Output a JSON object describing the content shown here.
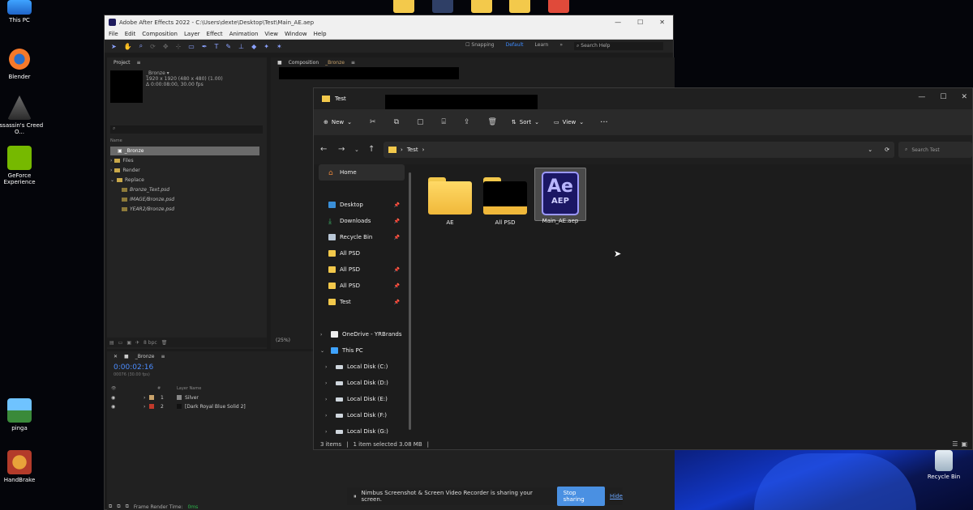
{
  "desktop": {
    "icons": [
      {
        "label": "This PC",
        "icon": "monitor-icon"
      },
      {
        "label": "Blender",
        "icon": "blender-icon"
      },
      {
        "label": "Assassin's Creed O...",
        "icon": "assassins-creed-icon"
      },
      {
        "label": "GeForce Experience",
        "icon": "geforce-icon"
      },
      {
        "label": "pinga",
        "icon": "image-icon"
      },
      {
        "label": "HandBrake",
        "icon": "handbrake-icon"
      },
      {
        "label": "Recycle Bin",
        "icon": "recycle-bin-icon"
      }
    ]
  },
  "ae": {
    "title": "Adobe After Effects 2022 - C:\\Users\\dexte\\Desktop\\Test\\Main_AE.aep",
    "menu": [
      "File",
      "Edit",
      "Composition",
      "Layer",
      "Effect",
      "Animation",
      "View",
      "Window",
      "Help"
    ],
    "snapping": "Snapping",
    "workspace_default": "Default",
    "workspace_learn": "Learn",
    "search_help": "Search Help",
    "project_tab": "Project",
    "comp_tab": "Composition",
    "comp_name": "_Bronze",
    "info_name": "_Bronze ▾",
    "info_line1": "1920 x 1920  (480 x 480) (1.00)",
    "info_line2": "Δ 0:00:08:00, 30.00 fps",
    "col_name": "Name",
    "project_items": [
      {
        "label": "_Bronze",
        "level": 0,
        "selected": true
      },
      {
        "label": "Files",
        "level": 0,
        "selected": false
      },
      {
        "label": "Render",
        "level": 0,
        "selected": false
      },
      {
        "label": "Replace",
        "level": 0,
        "selected": false
      },
      {
        "label": "Bronze_Text.psd",
        "level": 1,
        "selected": false
      },
      {
        "label": "IMAGE/Bronze.psd",
        "level": 1,
        "selected": false
      },
      {
        "label": "YEAR2/Bronze.psd",
        "level": 1,
        "selected": false
      }
    ],
    "bpc": "8 bpc",
    "zoom": "(25%)",
    "timecode": "0:00:02:16",
    "fps_small": "00076 (30.00 fps)",
    "layer_col": "Layer Name",
    "layers": [
      {
        "num": "1",
        "name": "Silver",
        "color": "#c9a36b"
      },
      {
        "num": "2",
        "name": "[Dark Royal Blue Solid 2]",
        "color": "#c0392b"
      }
    ],
    "frame_render_label": "Frame Render Time:",
    "frame_render_value": "0ms"
  },
  "explorer": {
    "tab_title": "Test",
    "cmd_new": "New",
    "cmd_sort": "Sort",
    "cmd_view": "View",
    "address_seg": "Test",
    "search_placeholder": "Search Test",
    "sidebar": [
      {
        "label": "Home",
        "icon": "home-icon",
        "pinned": false,
        "expand": ""
      },
      {
        "label": "Desktop",
        "icon": "desktop-icon",
        "pinned": true,
        "expand": ""
      },
      {
        "label": "Downloads",
        "icon": "download-icon",
        "pinned": true,
        "expand": ""
      },
      {
        "label": "Recycle Bin",
        "icon": "recycle-bin-icon",
        "pinned": true,
        "expand": ""
      },
      {
        "label": "All PSD",
        "icon": "folder-icon",
        "pinned": false,
        "expand": ""
      },
      {
        "label": "All PSD",
        "icon": "folder-icon",
        "pinned": true,
        "expand": ""
      },
      {
        "label": "All PSD",
        "icon": "folder-icon",
        "pinned": true,
        "expand": ""
      },
      {
        "label": "Test",
        "icon": "folder-icon",
        "pinned": true,
        "expand": ""
      },
      {
        "label": "OneDrive - YRBrands",
        "icon": "document-icon",
        "pinned": false,
        "expand": ">"
      },
      {
        "label": "This PC",
        "icon": "monitor-icon",
        "pinned": false,
        "expand": "v"
      },
      {
        "label": "Local Disk (C:)",
        "icon": "drive-icon",
        "pinned": false,
        "expand": ">"
      },
      {
        "label": "Local Disk (D:)",
        "icon": "drive-icon",
        "pinned": false,
        "expand": ">"
      },
      {
        "label": "Local Disk (E:)",
        "icon": "drive-icon",
        "pinned": false,
        "expand": ">"
      },
      {
        "label": "Local Disk (F:)",
        "icon": "drive-icon",
        "pinned": false,
        "expand": ">"
      },
      {
        "label": "Local Disk (G:)",
        "icon": "drive-icon",
        "pinned": false,
        "expand": ">"
      }
    ],
    "files": [
      {
        "label": "AE",
        "type": "folder"
      },
      {
        "label": "All PSD",
        "type": "folder-black"
      },
      {
        "label": "Main_AE.aep",
        "type": "aep",
        "ae": "Ae",
        "ext": "AEP"
      }
    ],
    "status_items": "3 items",
    "status_selected": "1 item selected  3.08 MB"
  },
  "share": {
    "message": "Nimbus Screenshot & Screen Video Recorder is sharing your screen.",
    "stop": "Stop sharing",
    "hide": "Hide"
  },
  "colors": {
    "ae_blue": "#4c8dff",
    "folder_yellow": "#f2c84b",
    "aep_purple": "#1b1764",
    "share_button": "#4a90e2"
  }
}
